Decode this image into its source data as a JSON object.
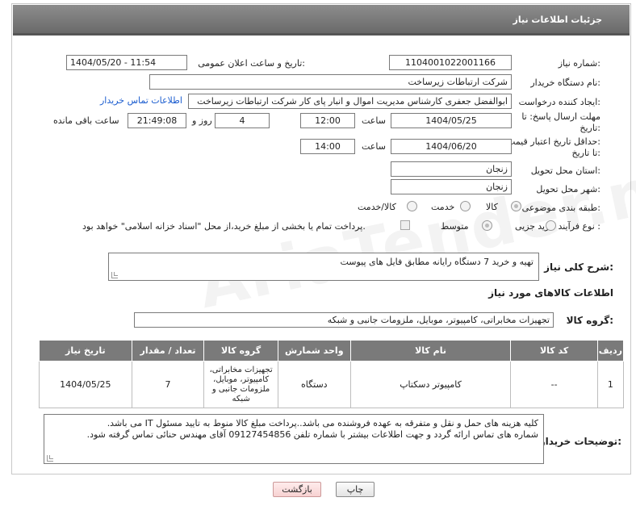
{
  "header": {
    "title": "جزئیات اطلاعات نیاز"
  },
  "fields": {
    "need_number_label": "شماره نیاز:",
    "need_number": "1104001022001166",
    "announce_label": "تاریخ و ساعت اعلان عمومی:",
    "announce_value": "1404/05/20 - 11:54",
    "buyer_label": "نام دستگاه خریدار:",
    "buyer_value": "شرکت ارتباطات زیرساخت",
    "creator_label": "ایجاد کننده درخواست:",
    "creator_value": "ابوالفضل جعفری کارشناس مدیریت اموال و انبار پای کار  شرکت ارتباطات زیرساخت",
    "contact_link": "اطلاعات تماس خریدار",
    "reply_label_1": "مهلت ارسال پاسخ: تا",
    "reply_label_2": "تاریخ:",
    "reply_date": "1404/05/25",
    "time_label": "ساعت",
    "reply_time": "12:00",
    "days_value": "4",
    "days_label": "روز و",
    "remaining_time": "21:49:08",
    "remaining_label": "ساعت باقی مانده",
    "price_label_1": "حداقل تاریخ اعتبار قیمت:",
    "price_label_2": "تا تاریخ:",
    "price_date": "1404/06/20",
    "price_time": "14:00",
    "province_label": "استان محل تحویل:",
    "province_value": "زنجان",
    "city_label": "شهر محل تحویل:",
    "city_value": "زنجان",
    "category_label": "طبقه بندی موضوعی:",
    "category_options": [
      "کالا",
      "خدمت",
      "کالا/خدمت"
    ],
    "process_label": "نوع فرآیند خرید :",
    "process_options": [
      "جزیی",
      "متوسط"
    ],
    "payment_note": "پرداخت تمام یا بخشی از مبلغ خرید،از محل \"اسناد خزانه اسلامی\" خواهد بود."
  },
  "description": {
    "label": "شرح کلی نیاز:",
    "value": "تهیه و خرید 7 دستگاه رایانه مطابق فایل های پیوست"
  },
  "goods": {
    "section_title": "اطلاعات کالاهای مورد نیاز",
    "group_label": "گروه کالا:",
    "group_value": "تجهیزات مخابراتی، کامپیوتر، موبایل، ملزومات جانبی و شبکه",
    "columns": [
      "ردیف",
      "کد کالا",
      "نام کالا",
      "واحد شمارش",
      "گروه کالا",
      "تعداد / مقدار",
      "تاریخ نیاز"
    ],
    "rows": [
      [
        "1",
        "--",
        "کامپیوتر دسکتاپ",
        "دستگاه",
        "تجهیزات مخابراتی، کامپیوتر، موبایل، ملزومات جانبی و شبکه",
        "7",
        "1404/05/25"
      ]
    ]
  },
  "buyer_notes": {
    "label": "توضیحات خریدار:",
    "line1": "کلیه هزینه های حمل و نقل و متفرقه به عهده فروشنده می باشد..پرداخت مبلغ کالا منوط به تایید مسئول IT  می باشد.",
    "line2": "شماره های تماس ارائه گردد و جهت اطلاعات بیشتر با شماره تلفن 09127454856  آقای مهندس حنائی تماس گرفته شود."
  },
  "buttons": {
    "print": "چاپ",
    "back": "بازگشت"
  }
}
